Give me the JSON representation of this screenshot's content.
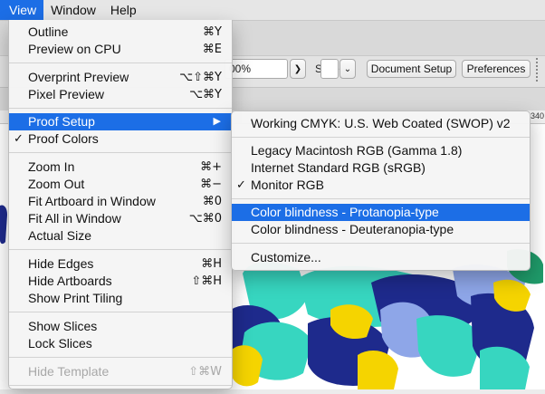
{
  "menubar": {
    "items": [
      {
        "label": "View",
        "active": true
      },
      {
        "label": "Window",
        "active": false
      },
      {
        "label": "Help",
        "active": false
      }
    ]
  },
  "toolbar": {
    "opacity_value": "00%",
    "style_label": "Style:",
    "document_setup": "Document Setup",
    "preferences": "Preferences",
    "ruler_mark": "340"
  },
  "view_menu": {
    "items": [
      {
        "label": "Outline",
        "shortcut": "⌘Y"
      },
      {
        "label": "Preview on CPU",
        "shortcut": "⌘E"
      },
      {
        "label": "Overprint Preview",
        "shortcut": "⌥⇧⌘Y"
      },
      {
        "label": "Pixel Preview",
        "shortcut": "⌥⌘Y"
      },
      {
        "label": "Proof Setup",
        "shortcut": "",
        "submenu": true,
        "highlighted": true
      },
      {
        "label": "Proof Colors",
        "shortcut": "",
        "checked": true
      },
      {
        "label": "Zoom In",
        "shortcut": "⌘+"
      },
      {
        "label": "Zoom Out",
        "shortcut": "⌘−"
      },
      {
        "label": "Fit Artboard in Window",
        "shortcut": "⌘0"
      },
      {
        "label": "Fit All in Window",
        "shortcut": "⌥⌘0"
      },
      {
        "label": "Actual Size",
        "shortcut": ""
      },
      {
        "label": "Hide Edges",
        "shortcut": "⌘H"
      },
      {
        "label": "Hide Artboards",
        "shortcut": "⇧⌘H"
      },
      {
        "label": "Show Print Tiling",
        "shortcut": ""
      },
      {
        "label": "Show Slices",
        "shortcut": ""
      },
      {
        "label": "Lock Slices",
        "shortcut": ""
      },
      {
        "label": "Hide Template",
        "shortcut": "⇧⌘W",
        "disabled": true
      }
    ]
  },
  "proof_setup_menu": {
    "items": [
      {
        "label": "Working CMYK: U.S. Web Coated (SWOP) v2"
      },
      {
        "label": "Legacy Macintosh RGB (Gamma 1.8)"
      },
      {
        "label": "Internet Standard RGB (sRGB)"
      },
      {
        "label": "Monitor RGB",
        "checked": true
      },
      {
        "label": "Color blindness - Protanopia-type",
        "highlighted": true
      },
      {
        "label": "Color blindness - Deuteranopia-type"
      },
      {
        "label": "Customize..."
      }
    ]
  },
  "glyphs": {
    "check": "✓",
    "submenu_arrow": "▶"
  },
  "colors": {
    "highlight": "#1c6ee6",
    "art_navy": "#1e2a8c",
    "art_teal": "#37d6c0",
    "art_yellow": "#f5d400",
    "art_periwinkle": "#8ea6e8",
    "art_green": "#1f9b6a"
  }
}
